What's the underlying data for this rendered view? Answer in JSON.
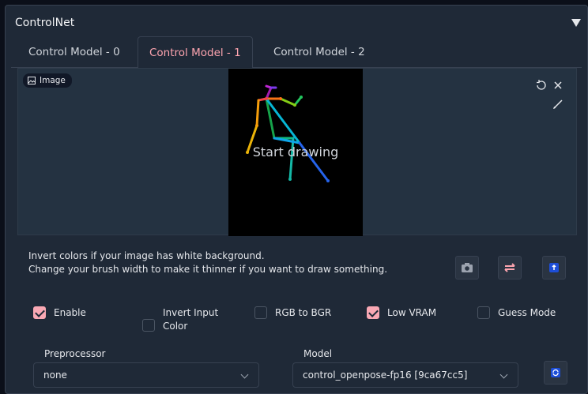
{
  "panel": {
    "title": "ControlNet"
  },
  "tabs": [
    {
      "label": "Control Model - 0"
    },
    {
      "label": "Control Model - 1",
      "active": true
    },
    {
      "label": "Control Model - 2"
    }
  ],
  "image": {
    "label": "Image",
    "canvas_text": "Start drawing"
  },
  "help": {
    "line1": "Invert colors if your image has white background.",
    "line2": "Change your brush width to make it thinner if you want to draw something."
  },
  "options": {
    "enable": {
      "label": "Enable",
      "checked": true
    },
    "invert_input_color": {
      "label_line1": "Invert Input",
      "label_line2": "Color",
      "checked": false
    },
    "rgb_to_bgr": {
      "label": "RGB to BGR",
      "checked": false
    },
    "low_vram": {
      "label": "Low VRAM",
      "checked": true
    },
    "guess_mode": {
      "label": "Guess Mode",
      "checked": false
    }
  },
  "preprocessor": {
    "label": "Preprocessor",
    "value": "none"
  },
  "model": {
    "label": "Model",
    "value": "control_openpose-fp16 [9ca67cc5]"
  },
  "colors": {
    "accent": "#fda4af",
    "check": "#f9a8b4",
    "blue_button": "#1d4ed8"
  }
}
